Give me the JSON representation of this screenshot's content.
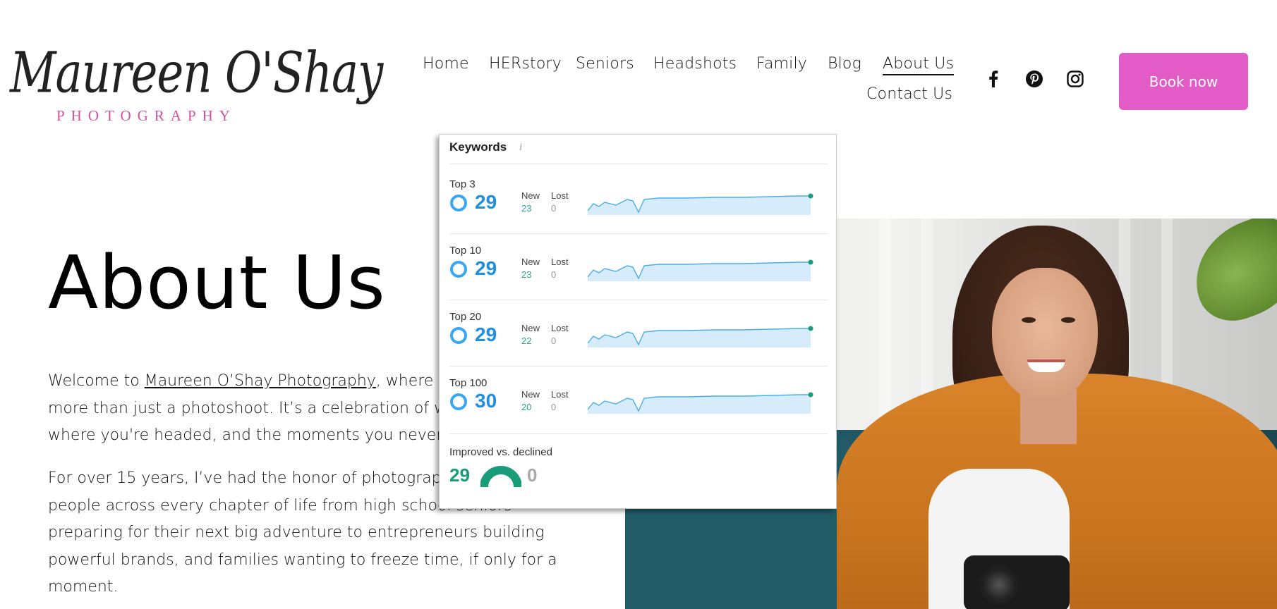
{
  "brand": {
    "script": "Maureen O'Shay",
    "sub": "PHOTOGRAPHY",
    "sub_color": "#d2529f"
  },
  "nav": {
    "items": [
      "Home",
      "HERstory",
      "Seniors",
      "Headshots",
      "Family",
      "Blog",
      "About Us",
      "Contact Us"
    ],
    "active": "About Us"
  },
  "social": [
    "facebook-icon",
    "pinterest-icon",
    "instagram-icon"
  ],
  "cta": {
    "label": "Book now",
    "color": "#e25bc6"
  },
  "hero": {
    "title": "About Us",
    "para1_prefix": "Welcome to ",
    "para1_link": "Maureen O’Shay Photography",
    "para1_rest": ", where ev",
    "para1_line2": "more than just a photoshoot. It’s a celebration of wh",
    "para1_line3": "where you're headed, and the moments you never w",
    "para2_line1": "For over 15 years, I’ve had the honor of photographi",
    "para2_line2": "people across every chapter of life from high school seniors",
    "para2_line3": "preparing for their next big adventure to entrepreneurs building",
    "para2_line4": "powerful brands, and families wanting to freeze time, if only for a",
    "para2_line5": "moment."
  },
  "keywords_panel": {
    "title": "Keywords",
    "info": "i",
    "new_label": "New",
    "lost_label": "Lost",
    "rows": [
      {
        "label": "Top 3",
        "value": "29",
        "new": "23",
        "lost": "0"
      },
      {
        "label": "Top 10",
        "value": "29",
        "new": "23",
        "lost": "0"
      },
      {
        "label": "Top 20",
        "value": "29",
        "new": "22",
        "lost": "0"
      },
      {
        "label": "Top 100",
        "value": "30",
        "new": "20",
        "lost": "0"
      }
    ],
    "improved_label": "Improved vs. declined",
    "improved": "29",
    "declined": "0",
    "accent": "#1f8fe0",
    "positive": "#1a9b7a"
  }
}
